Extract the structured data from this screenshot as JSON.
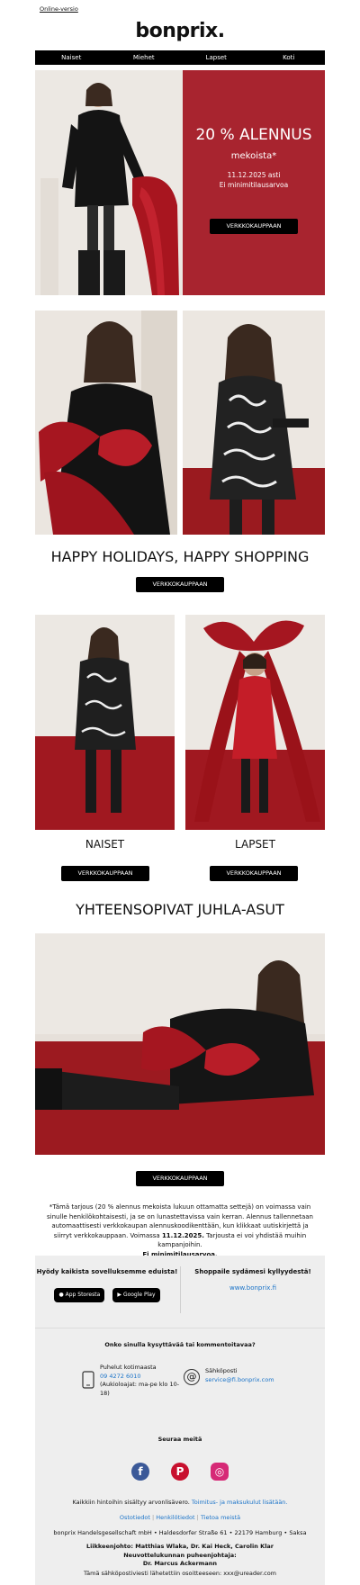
{
  "header": {
    "online_link": "Online-versio",
    "logo": "bonprix."
  },
  "nav": {
    "items": [
      "Naiset",
      "Miehet",
      "Lapset",
      "Koti"
    ]
  },
  "hero": {
    "headline": "20 % ALENNUS",
    "subheadline": "mekoista*",
    "date_line": "11.12.2025 asti",
    "min_line": "Ei minimitilausarvoa",
    "button": "VERKKOKAUPPAAN"
  },
  "section_happy": {
    "title": "HAPPY HOLIDAYS, HAPPY SHOPPING",
    "button": "VERKKOKAUPPAAN"
  },
  "categories": [
    {
      "label": "NAISET",
      "button": "VERKKOKAUPPAAN"
    },
    {
      "label": "LAPSET",
      "button": "VERKKOKAUPPAAN"
    }
  ],
  "section_outfits": {
    "title": "YHTEENSOPIVAT JUHLA-ASUT",
    "button": "VERKKOKAUPPAAN"
  },
  "disclaimer": {
    "text_1": "*Tämä tarjous (20 % alennus mekoista lukuun ottamatta settejä) on voimassa vain sinulle henkilökohtaisesti, ja se on lunastettavissa vain kerran. Alennus tallennetaan automaattisesti verkkokaupan alennuskoodikenttään, kun klikkaat uutiskirjettä ja siirryt verkkokauppaan. Voimassa",
    "date_bold": "11.12.2025.",
    "text_2": "Tarjousta ei voi yhdistää muihin kampanjoihin.",
    "min_bold": "Ei minimitilausarvoa."
  },
  "footer": {
    "apps_title": "Hyödy kaikista sovelluksemme eduista!",
    "app_store": "App Storesta",
    "google_play": "Google Play",
    "shop_title": "Shoppaile sydämesi kyllyydestä!",
    "shop_link": "www.bonprix.fi",
    "question": "Onko sinulla kysyttävää tai kommentoitavaa?",
    "phone_label": "Puhelut kotimaasta",
    "phone_number": "09 4272 6010",
    "phone_hours": "(Aukioloajat: ma-pe klo 10-18)",
    "email_label": "Sähköposti",
    "email_address": "service@fi.bonprix.com",
    "follow": "Seuraa meitä",
    "prices_text": "Kaikkiin hintoihin sisältyy arvonlisävero.",
    "prices_link": "Toimitus- ja maksukulut lisätään.",
    "links": [
      "Ostotiedot",
      "Henkilötiedot",
      "Tietoa meistä"
    ],
    "company": "bonprix Handelsgesellschaft mbH • Haldesdorfer Straße 61 • 22179 Hamburg • Saksa",
    "management": "Liikkeenjohto: Matthias Wlaka, Dr. Kai Heck, Carolin Klar",
    "board_title": "Neuvottelukunnan puheenjohtaja:",
    "board_name": "Dr. Marcus Ackermann",
    "sent_to": "Tämä sähköpostiviesti lähetettiin osoitteeseen: xxx@ureader.com"
  },
  "colors": {
    "brand_red": "#a8242f",
    "link_blue": "#1a73c8",
    "facebook": "#3b5998",
    "pinterest": "#c8102e",
    "instagram": "#d62976"
  }
}
